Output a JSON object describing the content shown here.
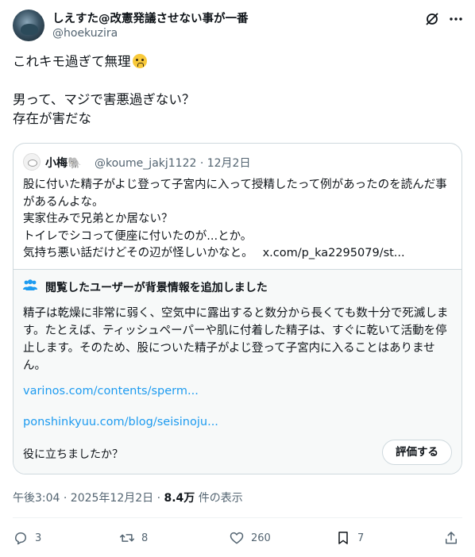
{
  "author": {
    "name": "しえすた@改憲発議させない事が一番",
    "handle": "@hoekuzira"
  },
  "post": {
    "line1": "これキモ過ぎて無理",
    "body": "男って、マジで害悪過ぎない？\n存在が害だな"
  },
  "quote": {
    "name": "小梅🐘",
    "meta": "@koume_jakj1122 · 12月2日",
    "line1": "股に付いた精子がよじ登って子宮内に入って授精したって例があったのを読んだ事があるんよな。",
    "line2": "実家住みで兄弟とか居ない？",
    "line3": "トイレでシコって便座に付いたのが...とか。",
    "line4": "気持ち悪い話だけどその辺が怪しいかなと。",
    "link": "x.com/p_ka2295079/st..."
  },
  "note": {
    "title": "閲覧したユーザーが背景情報を追加しました",
    "text": "精子は乾燥に非常に弱く、空気中に露出すると数分から長くても数十分で死滅します。たとえば、ティッシュペーパーや肌に付着した精子は、すぐに乾いて活動を停止します。そのため、股についた精子がよじ登って子宮内に入ることはありません。",
    "link1": "varinos.com/contents/sperm...",
    "link2": "ponshinkyuu.com/blog/seisinoju...",
    "helpful": "役に立ちましたか？",
    "rate": "評価する"
  },
  "meta": {
    "time": "午後3:04 · 2025年12月2日 · ",
    "views": "8.4万",
    "views_label": " 件の表示"
  },
  "actions": {
    "replies": "3",
    "reposts": "8",
    "likes": "260",
    "bookmarks": "7"
  },
  "icons": [
    "grok-icon",
    "more-icon",
    "people-icon",
    "reply-icon",
    "repost-icon",
    "like-icon",
    "bookmark-icon",
    "share-icon"
  ],
  "colors": {
    "link": "#1d9bf0",
    "secondary": "#536471",
    "border": "#cfd9de",
    "note_bg": "#f7f9f9"
  }
}
